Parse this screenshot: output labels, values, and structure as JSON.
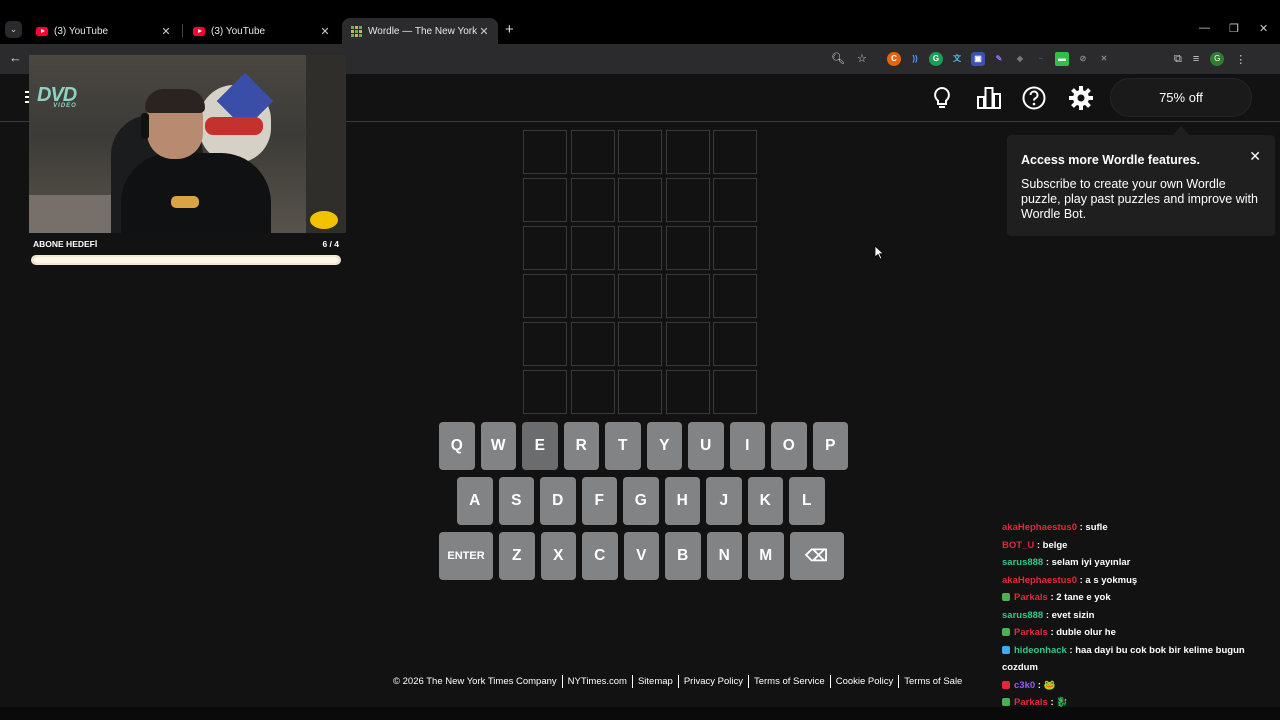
{
  "browser": {
    "tabs": [
      {
        "title": "(3) YouTube",
        "favicon": "youtube-icon"
      },
      {
        "title": "(3) YouTube",
        "favicon": "youtube-icon"
      },
      {
        "title": "Wordle — The New York Times",
        "favicon": "wordle-icon",
        "active": true
      }
    ],
    "new_tab_label": "+"
  },
  "header": {
    "promo_label": "75% off"
  },
  "popover": {
    "title": "Access more Wordle features.",
    "body": "Subscribe to create your own Wordle puzzle, play past puzzles and improve with Wordle Bot.",
    "close_label": "✕"
  },
  "keyboard": {
    "rows": [
      [
        "Q",
        "W",
        "E",
        "R",
        "T",
        "Y",
        "U",
        "I",
        "O",
        "P"
      ],
      [
        "A",
        "S",
        "D",
        "F",
        "G",
        "H",
        "J",
        "K",
        "L"
      ],
      [
        "ENTER",
        "Z",
        "X",
        "C",
        "V",
        "B",
        "N",
        "M",
        "⌫"
      ]
    ]
  },
  "footer": {
    "links": [
      "© 2026 The New York Times Company",
      "NYTimes.com",
      "Sitemap",
      "Privacy Policy",
      "Terms of Service",
      "Cookie Policy",
      "Terms of Sale"
    ]
  },
  "overlay": {
    "dvd_logo": "DVD",
    "dvd_sub": "VIDEO",
    "goal_label": "ABONE HEDEFİ",
    "goal_count": "6 / 4",
    "goal_progress": 1.0
  },
  "chat": [
    {
      "user": "akaHephaestus0",
      "text": ": sufle",
      "color": "#e0283c"
    },
    {
      "user": "BOT_U",
      "text": ": belge",
      "color": "#e0283c"
    },
    {
      "user": "sarus888",
      "text": ": selam iyi yayınlar",
      "color": "#2ec98b"
    },
    {
      "user": "akaHephaestus0",
      "text": ": a s yokmuş",
      "color": "#e0283c"
    },
    {
      "user": "Parkals",
      "text": ": 2 tane e yok",
      "color": "#e0283c",
      "badge": "#4caf50"
    },
    {
      "user": "sarus888",
      "text": ": evet sizin",
      "color": "#2ec98b"
    },
    {
      "user": "Parkals",
      "text": ": duble olur he",
      "color": "#e0283c",
      "badge": "#4caf50"
    },
    {
      "user": "hideonhack",
      "text": ": haa dayi bu cok bok bir kelime bugun cozdum",
      "color": "#2ec98b",
      "badge": "#3fa9f5"
    },
    {
      "user": "c3k0",
      "text": ": 🐸",
      "color": "#9b59ff",
      "badge": "#e0283c"
    },
    {
      "user": "Parkals",
      "text": ": 🐉",
      "color": "#e0283c",
      "badge": "#4caf50"
    }
  ]
}
